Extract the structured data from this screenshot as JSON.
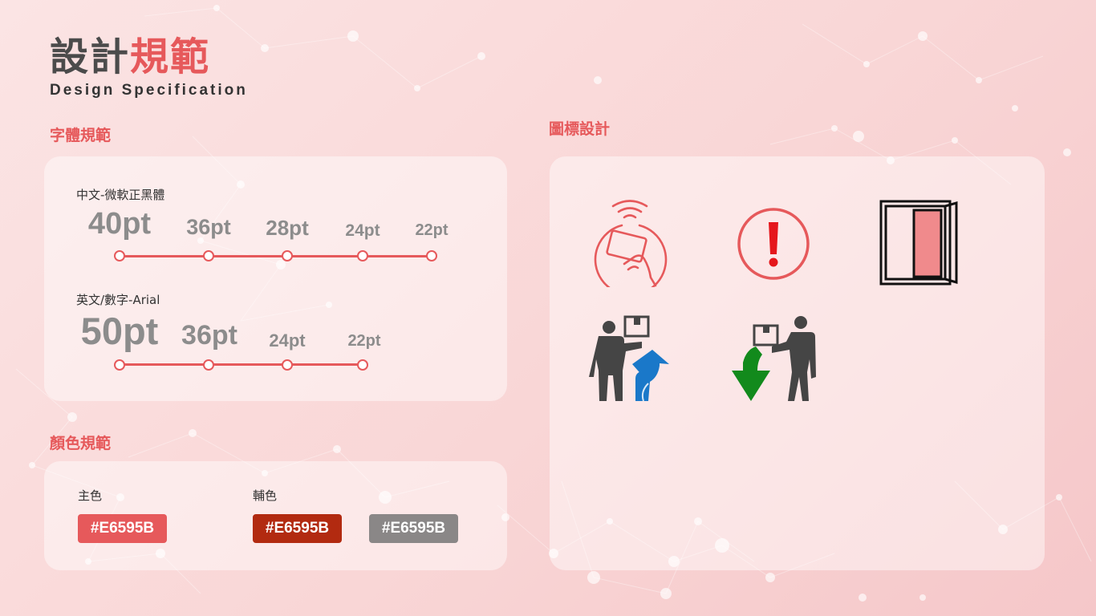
{
  "header": {
    "title_dark": "設計",
    "title_accent": "規範",
    "subtitle": "Design Specification"
  },
  "typography": {
    "section_title": "字體規範",
    "chinese": {
      "label": "中文-微軟正黑體",
      "sizes": [
        "40pt",
        "36pt",
        "28pt",
        "24pt",
        "22pt"
      ]
    },
    "english": {
      "label": "英文/數字-Arial",
      "sizes": [
        "50pt",
        "36pt",
        "24pt",
        "22pt"
      ]
    }
  },
  "colors": {
    "section_title": "顏色規範",
    "primary": {
      "label": "主色",
      "swatch": {
        "text": "#E6595B",
        "hex": "#e6595b"
      }
    },
    "secondary": {
      "label": "輔色",
      "swatches": [
        {
          "text": "#E6595B",
          "hex": "#b22a10"
        },
        {
          "text": "#E6595B",
          "hex": "#8a8787"
        }
      ]
    }
  },
  "icons": {
    "section_title": "圖標設計",
    "items": [
      "card-tap-icon",
      "alert-icon",
      "open-door-icon",
      "package-pickup-upload-icon",
      "package-delivery-download-icon"
    ]
  }
}
